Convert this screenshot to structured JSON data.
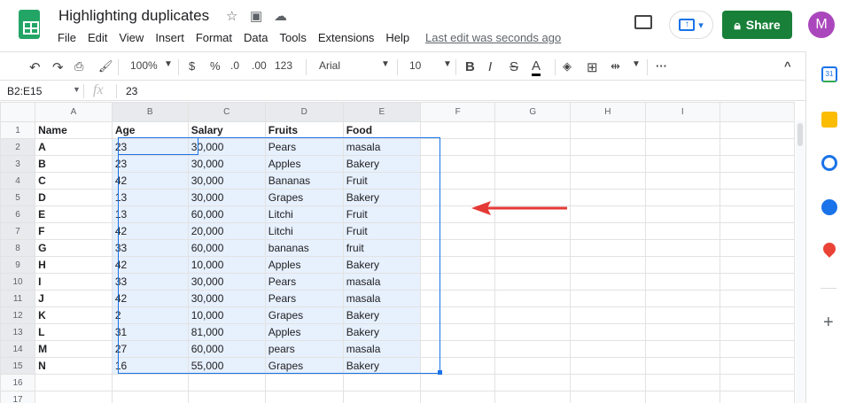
{
  "app": {
    "title": "Highlighting duplicates",
    "last_edit": "Last edit was seconds ago",
    "share": "Share",
    "avatar": "M"
  },
  "menu": [
    "File",
    "Edit",
    "View",
    "Insert",
    "Format",
    "Data",
    "Tools",
    "Extensions",
    "Help"
  ],
  "toolbar": {
    "zoom": "100%",
    "currency": "$",
    "percent": "%",
    "dec_less": ".0",
    "dec_more": ".00",
    "format": "123",
    "font": "Arial",
    "size": "10",
    "bold": "B",
    "italic": "I",
    "strike": "S",
    "text_color": "A"
  },
  "formula_bar": {
    "name_box": "B2:E15",
    "fx": "fx",
    "value": "23"
  },
  "columns": [
    "A",
    "B",
    "C",
    "D",
    "E",
    "F",
    "G",
    "H",
    "I"
  ],
  "rows": [
    [
      "Name",
      "Age",
      "Salary",
      "Fruits",
      "Food"
    ],
    [
      "A",
      "23",
      "30,000",
      "Pears",
      "masala"
    ],
    [
      "B",
      "23",
      "30,000",
      "Apples",
      "Bakery"
    ],
    [
      "C",
      "42",
      "30,000",
      "Bananas",
      "Fruit"
    ],
    [
      "D",
      "13",
      "30,000",
      "Grapes",
      "Bakery"
    ],
    [
      "E",
      "13",
      "60,000",
      "Litchi",
      "Fruit"
    ],
    [
      "F",
      "42",
      "20,000",
      "Litchi",
      "Fruit"
    ],
    [
      "G",
      "33",
      "60,000",
      "bananas",
      "fruit"
    ],
    [
      "H",
      "42",
      "10,000",
      "Apples",
      "Bakery"
    ],
    [
      "I",
      "33",
      "30,000",
      "Pears",
      "masala"
    ],
    [
      "J",
      "42",
      "30,000",
      "Pears",
      "masala"
    ],
    [
      "K",
      "2",
      "10,000",
      "Grapes",
      "Bakery"
    ],
    [
      "L",
      "31",
      "81,000",
      "Apples",
      "Bakery"
    ],
    [
      "M",
      "27",
      "60,000",
      "pears",
      "masala"
    ],
    [
      "N",
      "16",
      "55,000",
      "Grapes",
      "Bakery"
    ],
    [
      "",
      "",
      "",
      "",
      ""
    ],
    [
      "",
      "",
      "",
      "",
      ""
    ]
  ],
  "colors": {
    "accent": "#1a73e8",
    "share": "#188038",
    "selection": "#e7f0fd",
    "arrow": "#e53935"
  }
}
